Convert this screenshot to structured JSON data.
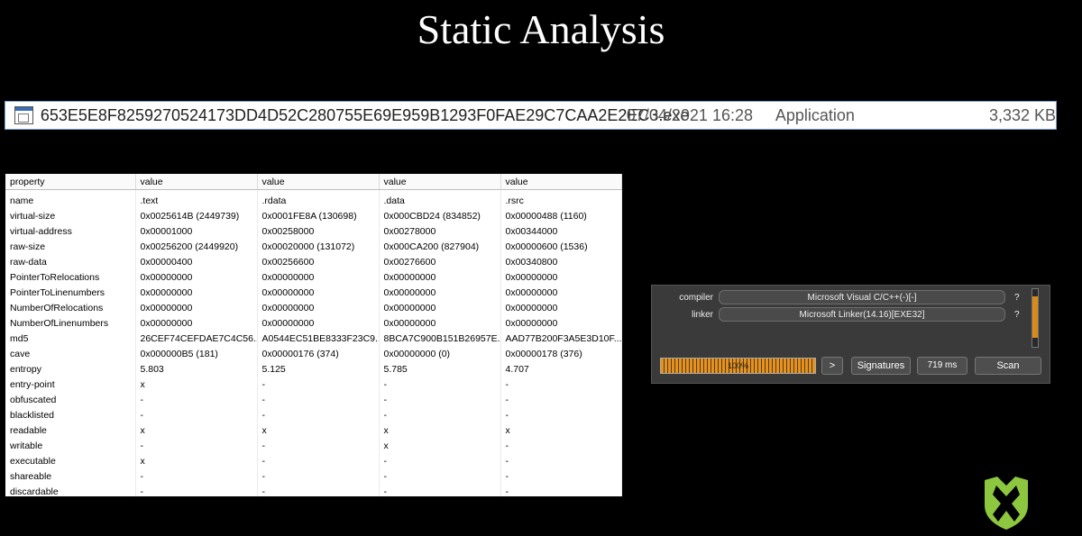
{
  "slide": {
    "title": "Static Analysis"
  },
  "file": {
    "name": "653E5E8F8259270524173DD4D52C280755E69E959B1293F0FAE29C7CAA2E2EC3.exe",
    "date": "07/04/2021 16:28",
    "type": "Application",
    "size": "3,332 KB"
  },
  "sections_table": {
    "headers": [
      "property",
      "value",
      "value",
      "value",
      "value"
    ],
    "rows": [
      [
        "name",
        ".text",
        ".rdata",
        ".data",
        ".rsrc"
      ],
      [
        "virtual-size",
        "0x0025614B (2449739)",
        "0x0001FE8A (130698)",
        "0x000CBD24 (834852)",
        "0x00000488 (1160)"
      ],
      [
        "virtual-address",
        "0x00001000",
        "0x00258000",
        "0x00278000",
        "0x00344000"
      ],
      [
        "raw-size",
        "0x00256200 (2449920)",
        "0x00020000 (131072)",
        "0x000CA200 (827904)",
        "0x00000600 (1536)"
      ],
      [
        "raw-data",
        "0x00000400",
        "0x00256600",
        "0x00276600",
        "0x00340800"
      ],
      [
        "PointerToRelocations",
        "0x00000000",
        "0x00000000",
        "0x00000000",
        "0x00000000"
      ],
      [
        "PointerToLinenumbers",
        "0x00000000",
        "0x00000000",
        "0x00000000",
        "0x00000000"
      ],
      [
        "NumberOfRelocations",
        "0x00000000",
        "0x00000000",
        "0x00000000",
        "0x00000000"
      ],
      [
        "NumberOfLinenumbers",
        "0x00000000",
        "0x00000000",
        "0x00000000",
        "0x00000000"
      ],
      [
        "md5",
        "26CEF74CEFDAE7C4C56...",
        "A0544EC51BE8333F23C9...",
        "8BCA7C900B151B26957E...",
        "AAD77B200F3A5E3D10F..."
      ],
      [
        "cave",
        "0x000000B5 (181)",
        "0x00000176 (374)",
        "0x00000000 (0)",
        "0x00000178 (376)"
      ],
      [
        "entropy",
        "5.803",
        "5.125",
        "5.785",
        "4.707"
      ],
      [
        "entry-point",
        "x",
        "-",
        "-",
        "-"
      ],
      [
        "obfuscated",
        "-",
        "-",
        "-",
        "-"
      ],
      [
        "blacklisted",
        "-",
        "-",
        "-",
        "-"
      ],
      [
        "readable",
        "x",
        "x",
        "x",
        "x"
      ],
      [
        "writable",
        "-",
        "-",
        "x",
        "-"
      ],
      [
        "executable",
        "x",
        "-",
        "-",
        "-"
      ],
      [
        "shareable",
        "-",
        "-",
        "-",
        "-"
      ],
      [
        "discardable",
        "-",
        "-",
        "-",
        "-"
      ]
    ]
  },
  "detector": {
    "rows": [
      {
        "label": "compiler",
        "value": "Microsoft Visual C/C++(-)[-]",
        "q": "?"
      },
      {
        "label": "linker",
        "value": "Microsoft Linker(14.16)[EXE32]",
        "q": "?"
      }
    ],
    "progress": {
      "fraction": 1.0,
      "label": "100%"
    },
    "arrow_label": ">",
    "signatures_label": "Signatures",
    "time_label": "719 ms",
    "scan_label": "Scan"
  },
  "colors": {
    "progress": "#e49220",
    "logo": "#8dc63f"
  },
  "logo_icon": "shield-logo-icon"
}
